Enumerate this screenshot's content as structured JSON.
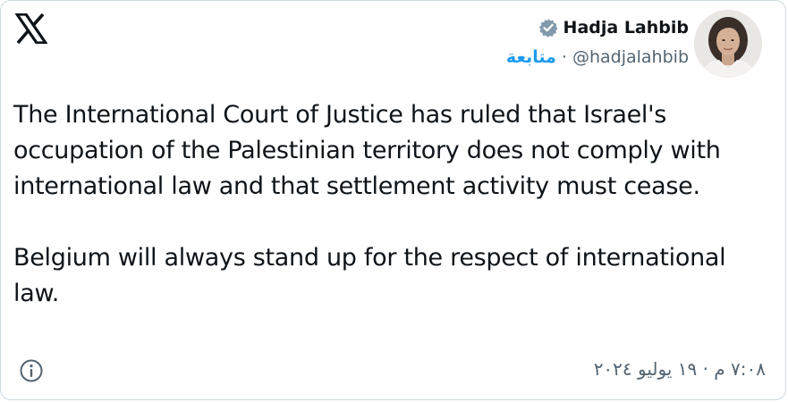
{
  "author": {
    "display_name": "Hadja Lahbib",
    "handle": "@hadjalahbib",
    "separator": "·",
    "follow_label": "متابعة"
  },
  "tweet": {
    "paragraph_1": "The International Court of Justice has ruled that Israel's occupation of the Palestinian territory does not comply with international law and that settlement activity must cease.",
    "paragraph_2": "Belgium will always stand up for the respect of international law."
  },
  "meta": {
    "timestamp": "٧:٠٨ م · ١٩ يوليو ٢٠٢٤"
  },
  "icons": {
    "logo": "x-logo-icon",
    "verified": "verified-badge-icon",
    "info": "info-icon"
  },
  "colors": {
    "text": "#0f1419",
    "secondary": "#536471",
    "accent": "#1d9bf0",
    "border": "#cfd9de"
  }
}
